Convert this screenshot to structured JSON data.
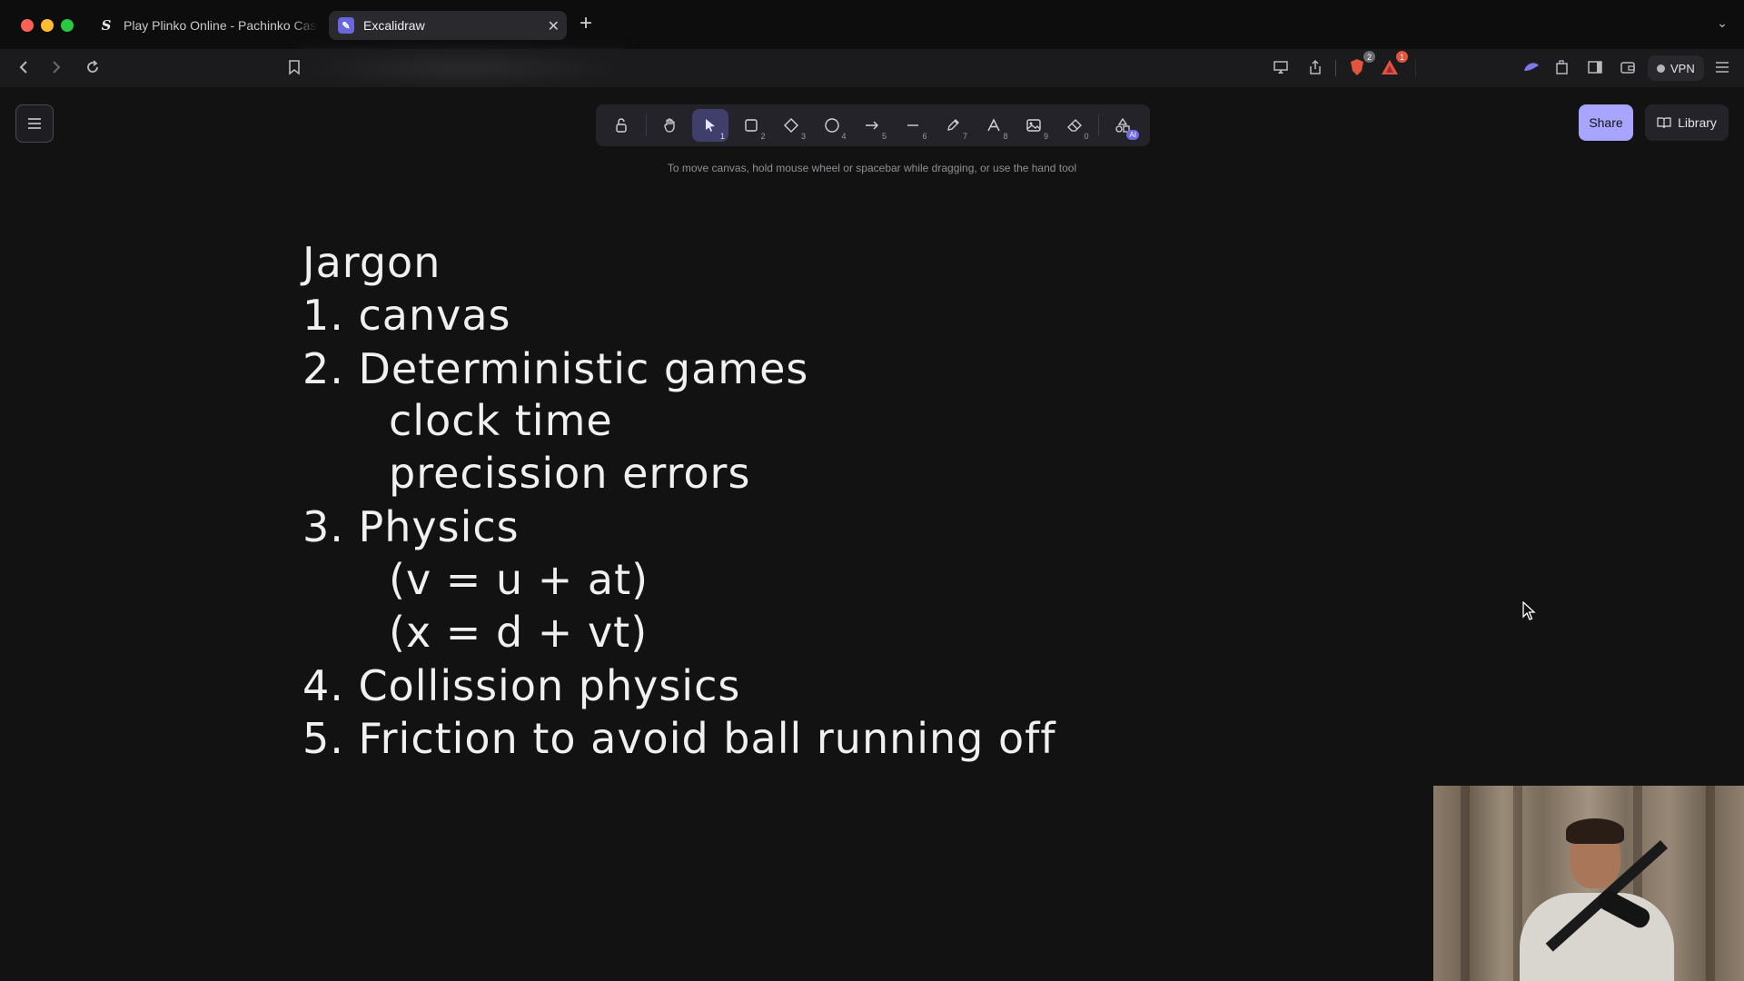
{
  "browser": {
    "tabs": [
      {
        "title": "Play Plinko Online - Pachinko Casi",
        "favicon": "S",
        "active": false
      },
      {
        "title": "Excalidraw",
        "favicon": "excalidraw-icon",
        "active": true
      }
    ],
    "new_tab_symbol": "+",
    "shield_count": "2",
    "alert_count": "1",
    "vpn_label": "VPN"
  },
  "app": {
    "toolbar": {
      "tools": [
        {
          "name": "lock",
          "icon": "lock-icon",
          "key": ""
        },
        {
          "name": "hand",
          "icon": "hand-icon",
          "key": ""
        },
        {
          "name": "selection",
          "icon": "pointer-icon",
          "key": "1",
          "selected": true
        },
        {
          "name": "rectangle",
          "icon": "rectangle-icon",
          "key": "2"
        },
        {
          "name": "diamond",
          "icon": "diamond-icon",
          "key": "3"
        },
        {
          "name": "ellipse",
          "icon": "ellipse-icon",
          "key": "4"
        },
        {
          "name": "arrow",
          "icon": "arrow-icon",
          "key": "5"
        },
        {
          "name": "line",
          "icon": "line-icon",
          "key": "6"
        },
        {
          "name": "draw",
          "icon": "pencil-icon",
          "key": "7"
        },
        {
          "name": "text",
          "icon": "text-icon",
          "key": "8"
        },
        {
          "name": "image",
          "icon": "image-icon",
          "key": "9"
        },
        {
          "name": "eraser",
          "icon": "eraser-icon",
          "key": "0"
        },
        {
          "name": "more-tools",
          "icon": "shapes-icon",
          "key": ""
        }
      ],
      "ai_badge": "AI"
    },
    "hint": "To move canvas, hold mouse wheel or spacebar while dragging, or use the hand tool",
    "share_label": "Share",
    "library_label": "Library",
    "accent_color": "#a8a5ff"
  },
  "canvas_text": {
    "heading": "Jargon",
    "line1": "1. canvas",
    "line2": "2. Deterministic games",
    "line2a": "clock time",
    "line2b": "precission errors",
    "line3": "3. Physics",
    "line3a": "(v = u + at)",
    "line3b": "(x = d + vt)",
    "line4": "4. Collission physics",
    "line5": "5. Friction to avoid ball running off"
  }
}
